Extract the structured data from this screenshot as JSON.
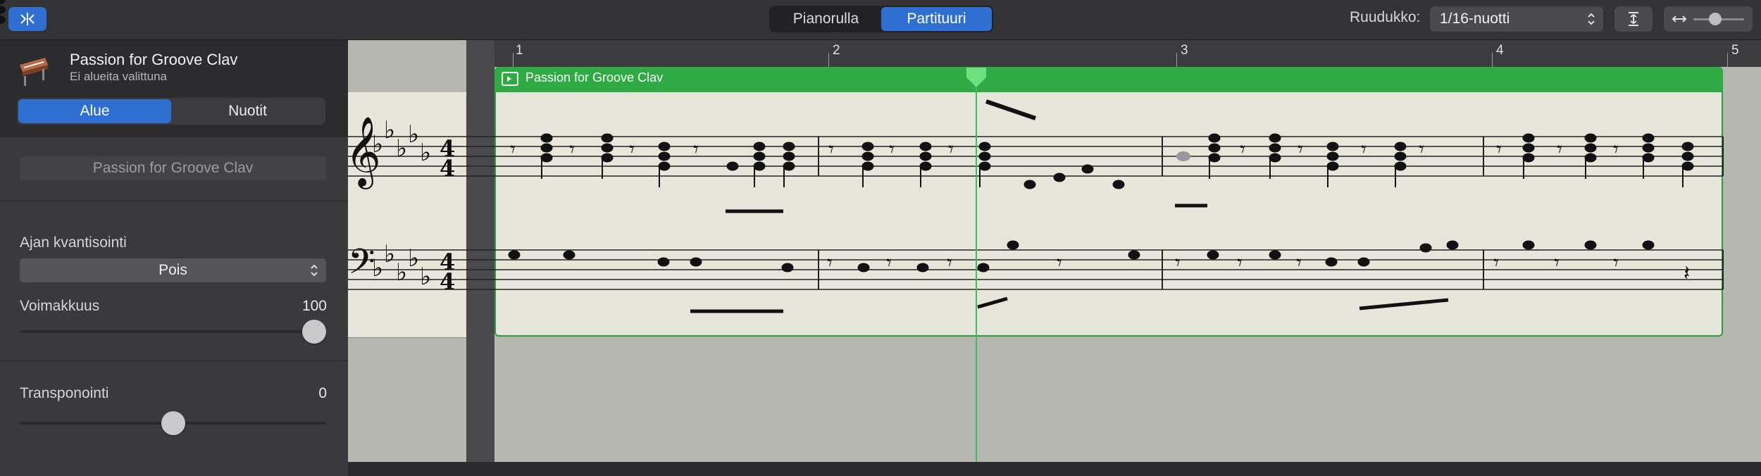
{
  "toolbar": {
    "view_tabs": [
      {
        "label": "Pianorulla",
        "active": false
      },
      {
        "label": "Partituuri",
        "active": true
      }
    ],
    "grid_label": "Ruudukko:",
    "grid_value": "1/16-nuotti",
    "accent_color": "#2f6fd1"
  },
  "inspector": {
    "instrument_name": "Passion for Groove Clav",
    "instrument_sub": "Ei alueita valittuna",
    "tabs": [
      {
        "label": "Alue",
        "active": true
      },
      {
        "label": "Nuotit",
        "active": false
      }
    ],
    "region_name": "Passion for Groove Clav",
    "quantize_label": "Ajan kvantisointi",
    "quantize_value": "Pois",
    "velocity_label": "Voimakkuus",
    "velocity_value": "100",
    "velocity_level": 1.0,
    "transpose_label": "Transponointi",
    "transpose_value": "0",
    "transpose_level": 0.5
  },
  "score": {
    "ruler_numbers": [
      "1",
      "2",
      "3",
      "4",
      "5"
    ],
    "region_title": "Passion for Groove Clav",
    "region_color": "#2faa45",
    "time_signature": "4/4",
    "key_signature": "5 flats"
  }
}
